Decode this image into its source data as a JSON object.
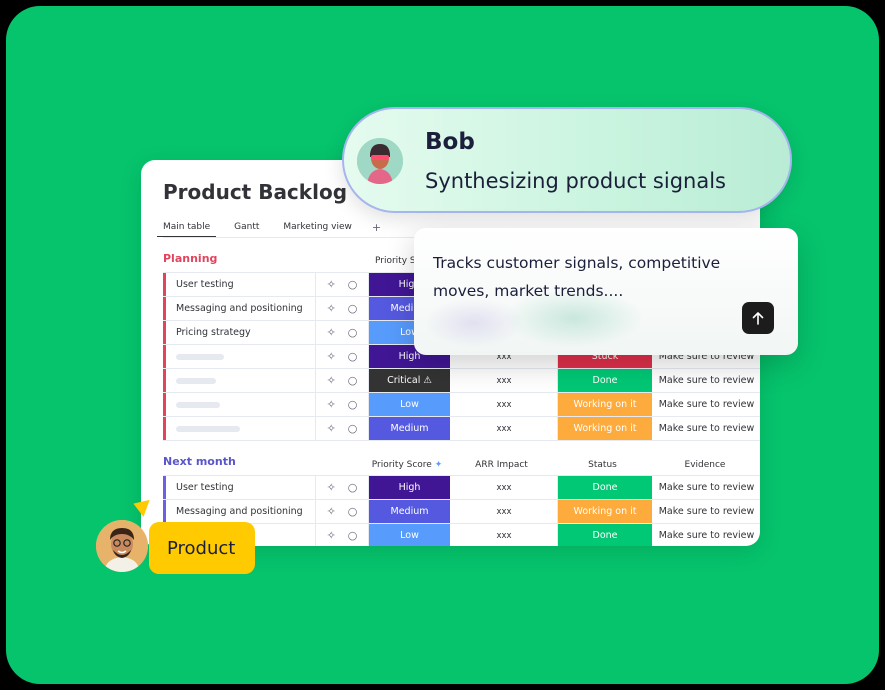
{
  "board": {
    "title": "Product Backlog",
    "tabs": [
      "Main table",
      "Gantt",
      "Marketing view"
    ],
    "add_tab": "+",
    "columns": {
      "priority": "Priority Score",
      "priority_short": "Priority Sco",
      "arr": "ARR Impact",
      "status": "Status",
      "evidence": "Evidence"
    },
    "groups": [
      {
        "title": "Planning",
        "color": "#e2445c",
        "rows": [
          {
            "name": "User testing",
            "priority": "High",
            "arr": "",
            "status": "",
            "evidence": ""
          },
          {
            "name": "Messaging and positioning",
            "priority": "Medium",
            "arr": "",
            "status": "",
            "evidence": ""
          },
          {
            "name": "Pricing strategy",
            "priority": "Low",
            "arr": "",
            "status": "",
            "evidence": ""
          },
          {
            "name": "",
            "priority": "High",
            "arr": "xxx",
            "status": "Stuck",
            "evidence": "Make sure to review"
          },
          {
            "name": "",
            "priority": "Critical ⚠",
            "arr": "xxx",
            "status": "Done",
            "evidence": "Make sure to review"
          },
          {
            "name": "",
            "priority": "Low",
            "arr": "xxx",
            "status": "Working on it",
            "evidence": "Make sure to review"
          },
          {
            "name": "",
            "priority": "Medium",
            "arr": "xxx",
            "status": "Working on it",
            "evidence": "Make sure to review"
          }
        ]
      },
      {
        "title": "Next month",
        "color": "#6a5fe6",
        "rows": [
          {
            "name": "User testing",
            "priority": "High",
            "arr": "xxx",
            "status": "Done",
            "evidence": "Make sure to review"
          },
          {
            "name": "Messaging and positioning",
            "priority": "Medium",
            "arr": "xxx",
            "status": "Working on it",
            "evidence": "Make sure to review"
          },
          {
            "name": "",
            "priority": "Low",
            "arr": "xxx",
            "status": "Done",
            "evidence": "Make sure to review"
          }
        ]
      }
    ]
  },
  "agent": {
    "name": "Bob",
    "subtitle": "Synthesizing product signals"
  },
  "prompt": {
    "text": "Tracks customer signals, competitive moves, market trends....",
    "send_icon": "arrow-up-icon"
  },
  "user_tag": {
    "label": "Product"
  },
  "colors": {
    "background": "#06c46c",
    "high": "#401694",
    "medium": "#5559df",
    "low": "#579bfc",
    "critical": "#333333",
    "done": "#00c875",
    "working": "#fdab3d",
    "stuck": "#df2f4a",
    "tag": "#ffcb00"
  }
}
